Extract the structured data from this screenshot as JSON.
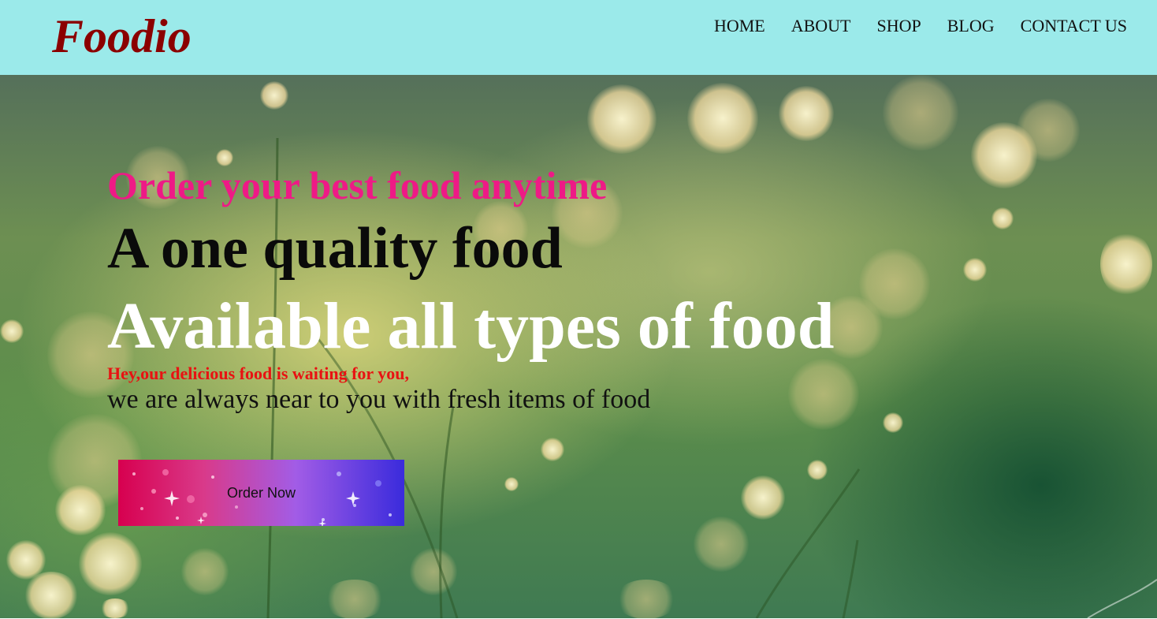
{
  "brand": {
    "logo_text": "Foodio"
  },
  "nav": {
    "items": [
      {
        "label": "HOME"
      },
      {
        "label": "ABOUT"
      },
      {
        "label": "SHOP"
      },
      {
        "label": "BLOG"
      },
      {
        "label": "CONTACT US"
      }
    ]
  },
  "hero": {
    "tagline": "Order your best food anytime",
    "headline": "A one quality food",
    "headline_2": "Available all types of food",
    "greeting": "Hey,our delicious food is waiting for you,",
    "description": "we are always near to you with fresh items of food",
    "cta_label": "Order Now"
  },
  "colors": {
    "navbar_bg": "#9beaea",
    "logo": "#8b0000",
    "tagline": "#ee1a86",
    "headline": "#0a0a0a",
    "headline_2": "#ffffff",
    "greeting": "#e81212",
    "cta_gradient_start": "#d7004f",
    "cta_gradient_end": "#3a2bdc"
  }
}
